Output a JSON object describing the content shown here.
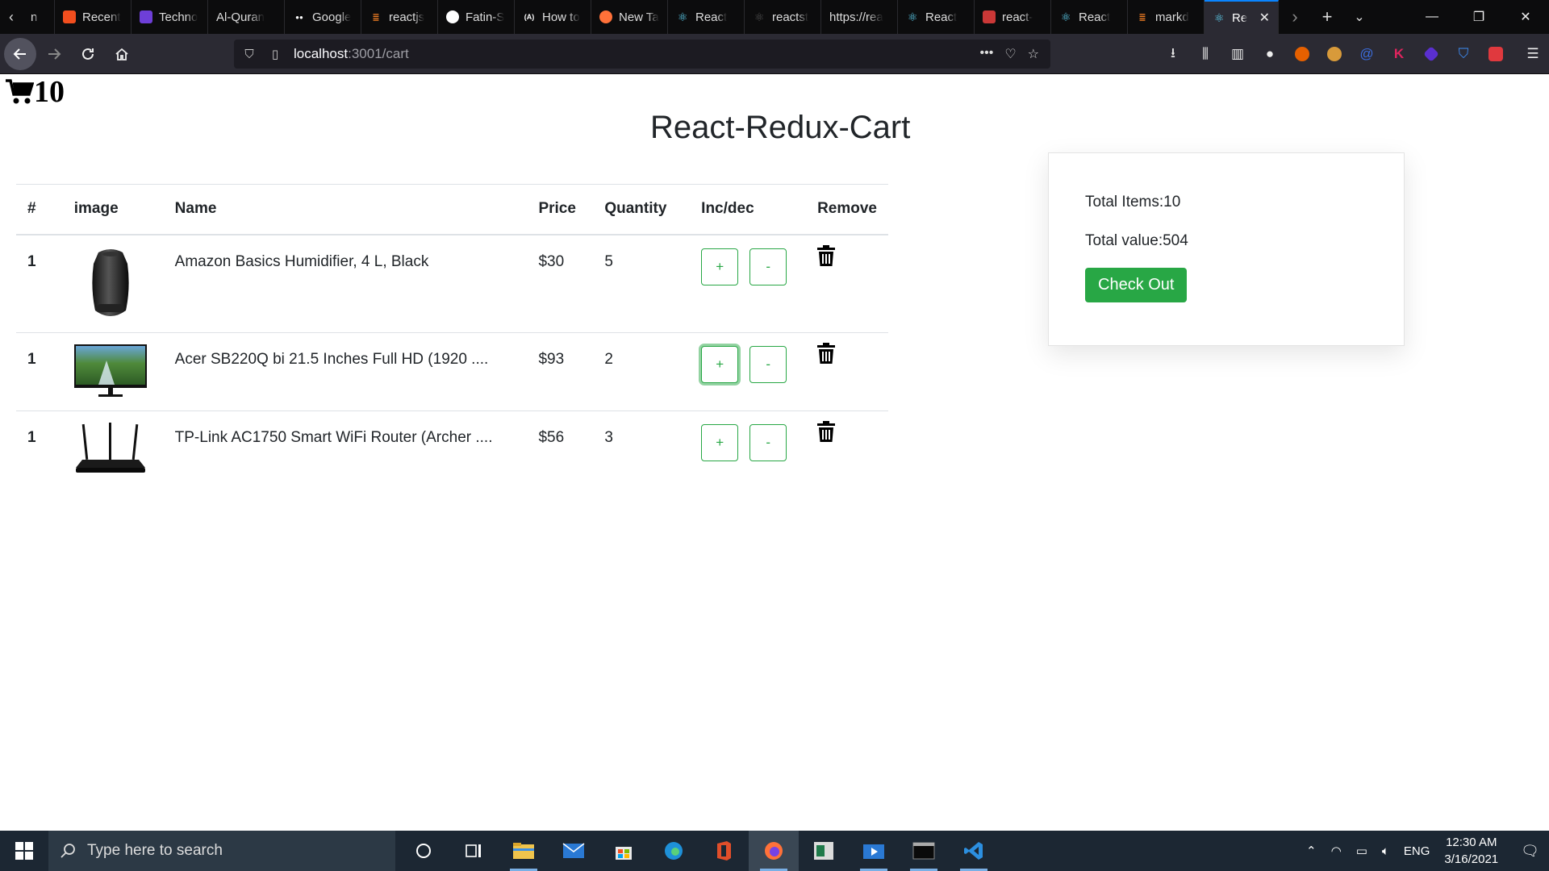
{
  "browser": {
    "tabs": [
      {
        "label": "n",
        "icon": "page-icon",
        "color": "#555"
      },
      {
        "label": "Recent",
        "icon": "figma-icon",
        "color": "#f24e1e"
      },
      {
        "label": "Techno",
        "icon": "hexagon-icon",
        "color": "#6e3fd8"
      },
      {
        "label": "Al-Quran",
        "icon": "blank-icon",
        "color": "#0c0c0d"
      },
      {
        "label": "Google",
        "icon": "medium-icon",
        "color": "#fff"
      },
      {
        "label": "reactjs",
        "icon": "stackoverflow-icon",
        "color": "#f48024"
      },
      {
        "label": "Fatin-S",
        "icon": "github-icon",
        "color": "#fff"
      },
      {
        "label": "How to",
        "icon": "dev-icon",
        "color": "#fff"
      },
      {
        "label": "New Tab",
        "icon": "firefox-icon",
        "color": "#ff7139"
      },
      {
        "label": "React",
        "icon": "react-icon",
        "color": "#61dafb"
      },
      {
        "label": "reactst",
        "icon": "react-dim-icon",
        "color": "#555"
      },
      {
        "label": "https://rea",
        "icon": "blank-icon",
        "color": "#0c0c0d"
      },
      {
        "label": "React",
        "icon": "react-icon",
        "color": "#61dafb"
      },
      {
        "label": "react-",
        "icon": "npm-icon",
        "color": "#cb3837"
      },
      {
        "label": "React",
        "icon": "react-icon",
        "color": "#61dafb"
      },
      {
        "label": "markd",
        "icon": "stackoverflow-icon",
        "color": "#f48024"
      }
    ],
    "active_tab": {
      "label": "Re",
      "icon": "react-icon",
      "color": "#61dafb"
    },
    "url_host": "localhost",
    "url_path": ":3001/cart"
  },
  "page": {
    "cart_count": "10",
    "title": "React-Redux-Cart",
    "table": {
      "headers": [
        "#",
        "image",
        "Name",
        "Price",
        "Quantity",
        "Inc/dec",
        "Remove"
      ],
      "rows": [
        {
          "index": "1",
          "name": "Amazon Basics Humidifier, 4 L, Black",
          "price": "$30",
          "quantity": "5",
          "image": "humidifier"
        },
        {
          "index": "1",
          "name": "Acer SB220Q bi 21.5 Inches Full HD (1920 ....",
          "price": "$93",
          "quantity": "2",
          "image": "monitor"
        },
        {
          "index": "1",
          "name": "TP-Link AC1750 Smart WiFi Router (Archer ....",
          "price": "$56",
          "quantity": "3",
          "image": "router"
        }
      ],
      "inc_label": "+",
      "dec_label": "-"
    },
    "summary": {
      "total_items": "Total Items:10",
      "total_value": "Total value:504",
      "checkout_label": "Check Out"
    },
    "colors": {
      "accent": "#28a745"
    }
  },
  "taskbar": {
    "search_placeholder": "Type here to search",
    "language": "ENG",
    "time": "12:30 AM",
    "date": "3/16/2021"
  }
}
